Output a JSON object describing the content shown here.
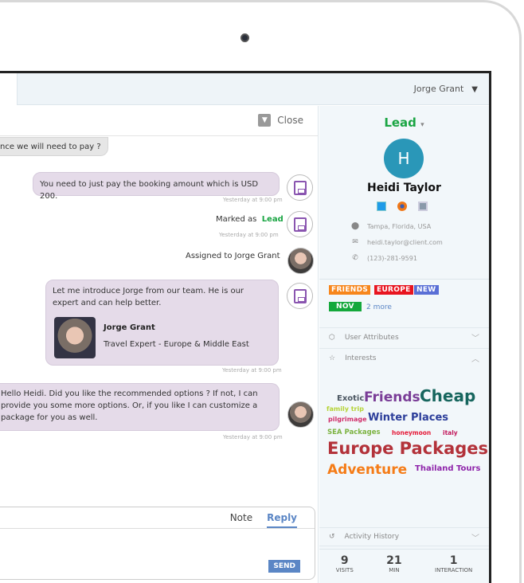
{
  "header": {
    "user_name": "Jorge Grant",
    "user_caret": "▼"
  },
  "chat": {
    "close_label": "Close",
    "messages": [
      {
        "text": "nce we will need to pay ?"
      },
      {
        "text": "You need to just pay the booking amount which is USD 200.",
        "time": "Yesterday at 9:00 pm"
      },
      {
        "prefix": "Marked as",
        "status": "Lead",
        "time": "Yesterday at 9:00 pm"
      },
      {
        "text": "Assigned to Jorge Grant"
      },
      {
        "text": "Let me introduce Jorge from our team. He is our expert and can help better.",
        "card_name": "Jorge Grant",
        "card_title": "Travel Expert - Europe & Middle East",
        "time": "Yesterday at 9:00 pm"
      },
      {
        "text": "Hello Heidi. Did you like the recommended options ? If not, I can provide you some more options. Or, if you like I can customize a package for you as well.",
        "time": "Yesterday at 9:00 pm"
      }
    ],
    "reply": {
      "tab_note": "Note",
      "tab_reply": "Reply",
      "active_tab": "Reply",
      "send_label": "SEND"
    }
  },
  "sidebar": {
    "status": "Lead",
    "status_caret": "▾",
    "avatar_letter": "H",
    "name": "Heidi Taylor",
    "device_icons": [
      "windows-icon",
      "firefox-icon",
      "desktop-icon"
    ],
    "location": "Tampa, Florida, USA",
    "email": "heidi.taylor@client.com",
    "phone": "(123)-281-9591",
    "tags": [
      {
        "label": "FRIENDS",
        "color": "#f7861c"
      },
      {
        "label": "EUROPE",
        "color": "#e8141f"
      },
      {
        "label": "NEW",
        "color": "#5a6fd6"
      },
      {
        "label": "NOV",
        "color": "#14a83b"
      }
    ],
    "more_tags": "2 more",
    "sections": {
      "user_attributes": "User Attributes",
      "interests": "Interests",
      "activity_history": "Activity History"
    },
    "interests": [
      {
        "word": "Exotic",
        "color": "#4a5560"
      },
      {
        "word": "Friends",
        "color": "#7a3d97"
      },
      {
        "word": "Cheap",
        "color": "#17665e"
      },
      {
        "word": "family trip",
        "color": "#b5d335"
      },
      {
        "word": "pilgrimage",
        "color": "#d0306b"
      },
      {
        "word": "Winter Places",
        "color": "#2c3e9a"
      },
      {
        "word": "SEA Packages",
        "color": "#7cb342"
      },
      {
        "word": "honeymoon",
        "color": "#e51c3a"
      },
      {
        "word": "italy",
        "color": "#c2185b"
      },
      {
        "word": "Europe Packages",
        "color": "#b3323a"
      },
      {
        "word": "Adventure",
        "color": "#f57c17"
      },
      {
        "word": "Thailand Tours",
        "color": "#8e24aa"
      }
    ],
    "stats": [
      {
        "value": "9",
        "label": "VISITS"
      },
      {
        "value": "21",
        "label": "MIN"
      },
      {
        "value": "1",
        "label": "INTERACTION"
      }
    ]
  }
}
